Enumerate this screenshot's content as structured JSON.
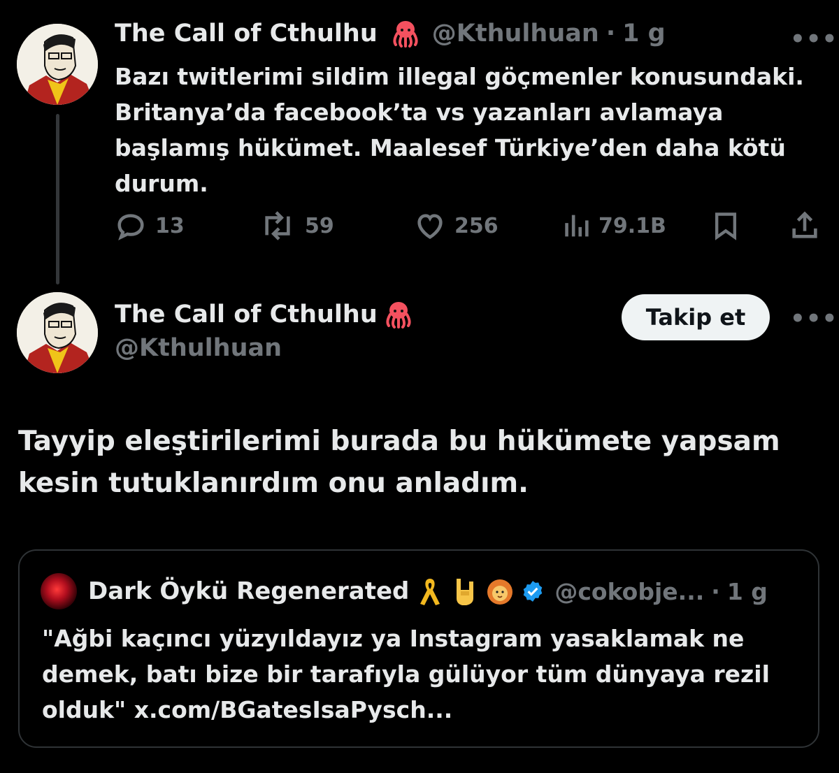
{
  "tweet1": {
    "name": "The Call of Cthulhu",
    "handle": "@Kthulhuan",
    "separator": "·",
    "time": "1 g",
    "text": "Bazı twitlerimi sildim illegal göçmenler konusundaki. Britanya’da facebook’ta vs yazanları avlamaya başlamış hükümet. Maalesef Türkiye’den daha kötü durum.",
    "replies": "13",
    "retweets": "59",
    "likes": "256",
    "views": "79.1B",
    "more": "•••"
  },
  "tweet2": {
    "name": "The Call of Cthulhu",
    "handle": "@Kthulhuan",
    "follow_label": "Takip et",
    "more": "•••",
    "text": "Tayyip eleştirilerimi burada bu hükümete yapsam kesin tutuklanırdım onu anladım."
  },
  "quote": {
    "name": "Dark Öykü Regenerated",
    "handle": "@cokobje...",
    "separator": "·",
    "time": "1 g",
    "text": "\"Ağbi kaçıncı yüzyıldayız ya Instagram yasaklamak ne demek, batı bize bir tarafıyla gülüyor tüm dünyaya rezil olduk\" x.com/BGatesIsaPysch..."
  },
  "colors": {
    "background": "#000000",
    "text": "#e7e9ea",
    "muted": "#71767b",
    "verified": "#1d9bf0",
    "octopus": "#f4515f",
    "follow_bg": "#eff3f4"
  },
  "icons": [
    "octopus-emoji",
    "reply-icon",
    "retweet-icon",
    "like-icon",
    "views-icon",
    "bookmark-icon",
    "share-icon",
    "more-icon",
    "ribbon-emoji",
    "rock-hand-emoji",
    "lion-emoji",
    "verified-badge-icon"
  ]
}
